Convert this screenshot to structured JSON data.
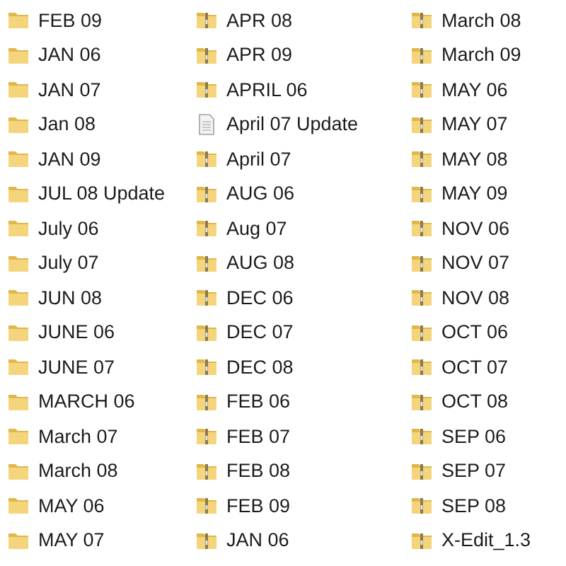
{
  "columns": [
    {
      "items": [
        {
          "name": "FEB 09",
          "kind": "folder"
        },
        {
          "name": "JAN 06",
          "kind": "folder"
        },
        {
          "name": "JAN 07",
          "kind": "folder"
        },
        {
          "name": "Jan 08",
          "kind": "folder"
        },
        {
          "name": "JAN 09",
          "kind": "folder"
        },
        {
          "name": "JUL 08 Update",
          "kind": "folder"
        },
        {
          "name": "July 06",
          "kind": "folder"
        },
        {
          "name": "July 07",
          "kind": "folder"
        },
        {
          "name": "JUN 08",
          "kind": "folder"
        },
        {
          "name": "JUNE 06",
          "kind": "folder"
        },
        {
          "name": "JUNE 07",
          "kind": "folder"
        },
        {
          "name": "MARCH 06",
          "kind": "folder"
        },
        {
          "name": "March 07",
          "kind": "folder"
        },
        {
          "name": "March 08",
          "kind": "folder"
        },
        {
          "name": "MAY 06",
          "kind": "folder"
        },
        {
          "name": "MAY 07",
          "kind": "folder"
        }
      ]
    },
    {
      "items": [
        {
          "name": "APR 08",
          "kind": "zip-folder"
        },
        {
          "name": "APR 09",
          "kind": "zip-folder"
        },
        {
          "name": "APRIL 06",
          "kind": "zip-folder"
        },
        {
          "name": "April 07 Update",
          "kind": "document"
        },
        {
          "name": "April 07",
          "kind": "zip-folder"
        },
        {
          "name": "AUG 06",
          "kind": "zip-folder"
        },
        {
          "name": "Aug 07",
          "kind": "zip-folder"
        },
        {
          "name": "AUG 08",
          "kind": "zip-folder"
        },
        {
          "name": "DEC 06",
          "kind": "zip-folder"
        },
        {
          "name": "DEC 07",
          "kind": "zip-folder"
        },
        {
          "name": "DEC 08",
          "kind": "zip-folder"
        },
        {
          "name": "FEB 06",
          "kind": "zip-folder"
        },
        {
          "name": "FEB 07",
          "kind": "zip-folder"
        },
        {
          "name": "FEB 08",
          "kind": "zip-folder"
        },
        {
          "name": "FEB 09",
          "kind": "zip-folder"
        },
        {
          "name": "JAN 06",
          "kind": "zip-folder"
        }
      ]
    },
    {
      "items": [
        {
          "name": "March 08",
          "kind": "zip-folder"
        },
        {
          "name": "March 09",
          "kind": "zip-folder"
        },
        {
          "name": "MAY 06",
          "kind": "zip-folder"
        },
        {
          "name": "MAY 07",
          "kind": "zip-folder"
        },
        {
          "name": "MAY 08",
          "kind": "zip-folder"
        },
        {
          "name": "MAY 09",
          "kind": "zip-folder"
        },
        {
          "name": "NOV 06",
          "kind": "zip-folder"
        },
        {
          "name": "NOV 07",
          "kind": "zip-folder"
        },
        {
          "name": "NOV 08",
          "kind": "zip-folder"
        },
        {
          "name": "OCT 06",
          "kind": "zip-folder"
        },
        {
          "name": "OCT 07",
          "kind": "zip-folder"
        },
        {
          "name": "OCT 08",
          "kind": "zip-folder"
        },
        {
          "name": "SEP 06",
          "kind": "zip-folder"
        },
        {
          "name": "SEP 07",
          "kind": "zip-folder"
        },
        {
          "name": "SEP 08",
          "kind": "zip-folder"
        },
        {
          "name": "X-Edit_1.3",
          "kind": "zip-folder"
        }
      ]
    }
  ]
}
